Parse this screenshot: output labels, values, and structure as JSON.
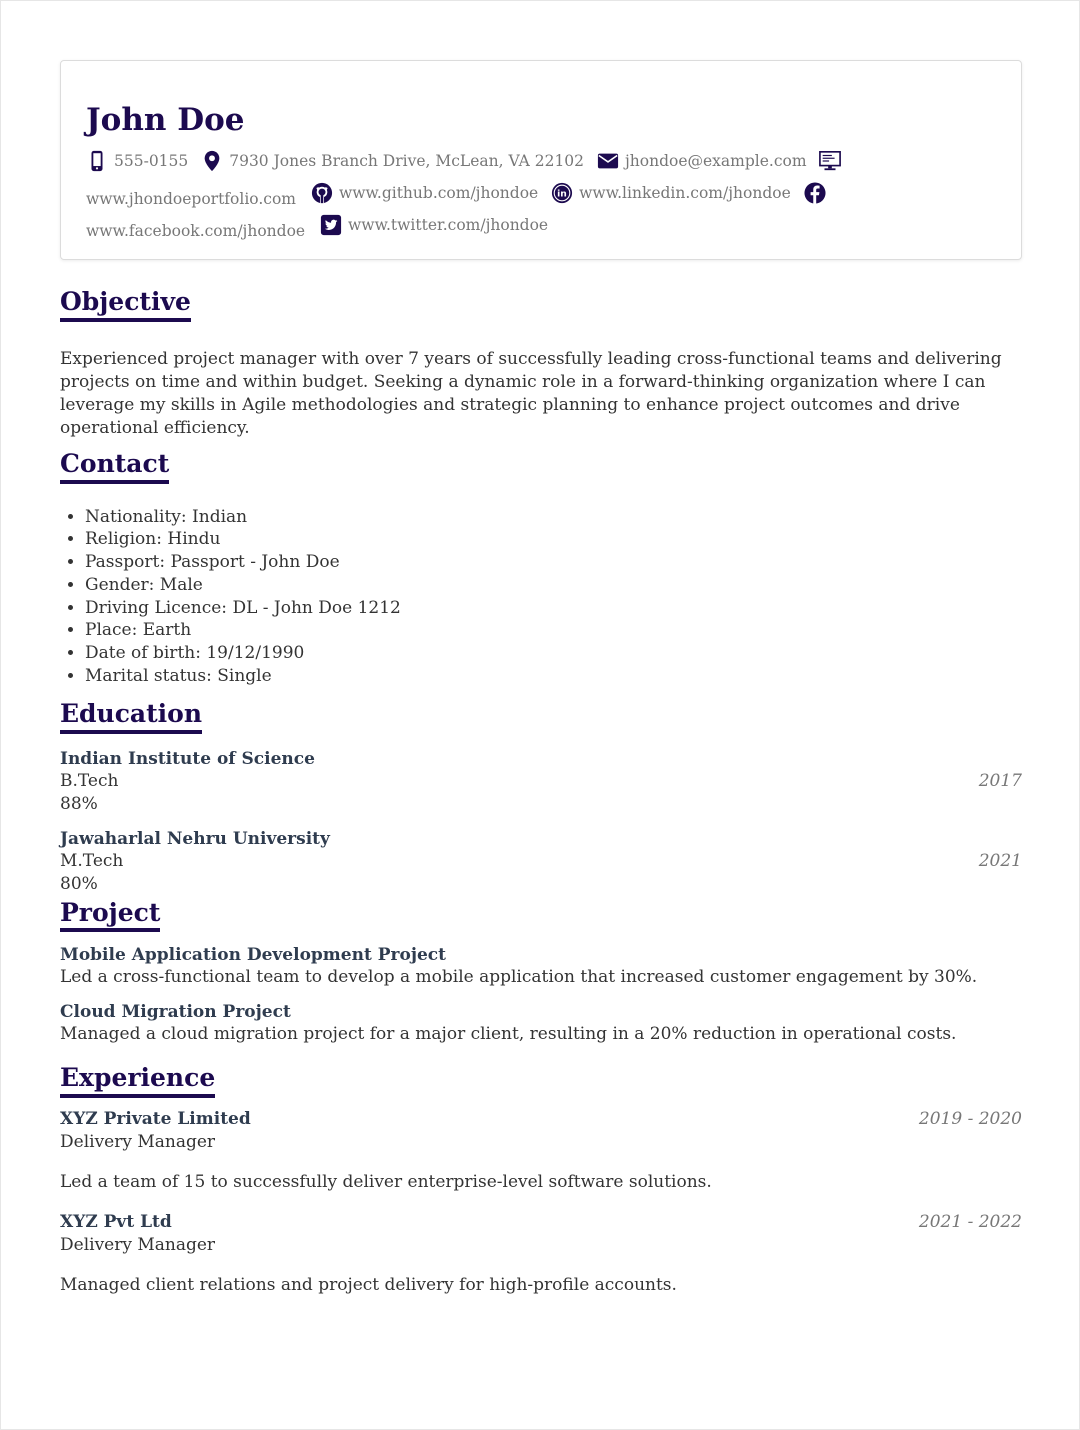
{
  "header": {
    "name": "John Doe",
    "phone": "555-0155",
    "address": "7930 Jones Branch Drive, McLean, VA 22102",
    "email": "jhondoe@example.com",
    "portfolio": "www.jhondoeportfolio.com",
    "github": "www.github.com/jhondoe",
    "linkedin": "www.linkedin.com/jhondoe",
    "facebook": "www.facebook.com/jhondoe",
    "twitter": "www.twitter.com/jhondoe"
  },
  "objective": {
    "title": "Objective",
    "text": "Experienced project manager with over 7 years of successfully leading cross-functional teams and delivering projects on time and within budget. Seeking a dynamic role in a forward-thinking organization where I can leverage my skills in Agile methodologies and strategic planning to enhance project outcomes and drive operational efficiency."
  },
  "contact": {
    "title": "Contact",
    "items": [
      "Nationality: Indian",
      "Religion: Hindu",
      "Passport: Passport - John Doe",
      "Gender: Male",
      "Driving Licence: DL - John Doe 1212",
      "Place: Earth",
      "Date of birth: 19/12/1990",
      "Marital status: Single"
    ]
  },
  "education": {
    "title": "Education",
    "items": [
      {
        "school": "Indian Institute of Science",
        "degree": "B.Tech",
        "year": "2017",
        "score": "88%"
      },
      {
        "school": "Jawaharlal Nehru University",
        "degree": "M.Tech",
        "year": "2021",
        "score": "80%"
      }
    ]
  },
  "project": {
    "title": "Project",
    "items": [
      {
        "name": "Mobile Application Development Project",
        "desc": "Led a cross-functional team to develop a mobile application that increased customer engagement by 30%."
      },
      {
        "name": "Cloud Migration Project",
        "desc": "Managed a cloud migration project for a major client, resulting in a 20% reduction in operational costs."
      }
    ]
  },
  "experience": {
    "title": "Experience",
    "items": [
      {
        "company": "XYZ Private Limited",
        "dates": "2019 - 2020",
        "role": "Delivery Manager",
        "desc": "Led a team of 15 to successfully deliver enterprise-level software solutions."
      },
      {
        "company": "XYZ Pvt Ltd",
        "dates": "2021 - 2022",
        "role": "Delivery Manager",
        "desc": "Managed client relations and project delivery for high-profile accounts."
      }
    ]
  },
  "icons": {
    "accent": "#1c0a4f",
    "phone": "mobile-phone-icon",
    "address": "map-marker-icon",
    "email": "envelope-icon",
    "portfolio": "monitor-icon",
    "github": "github-icon",
    "linkedin": "linkedin-icon",
    "facebook": "facebook-icon",
    "twitter": "twitter-icon"
  }
}
